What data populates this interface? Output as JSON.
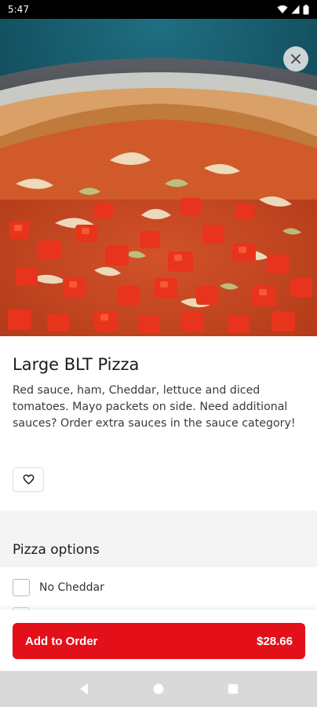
{
  "status_bar": {
    "time": "5:47",
    "icons": [
      "wifi-icon",
      "signal-icon",
      "battery-icon"
    ]
  },
  "hero": {
    "image": "pizza-photo",
    "close_icon": "close-icon"
  },
  "item": {
    "title": "Large BLT Pizza",
    "description": "Red sauce, ham, Cheddar, lettuce and diced tomatoes. Mayo packets on side. Need additional sauces? Order extra sauces in the sauce category!",
    "favorite_icon": "heart-outline-icon"
  },
  "options": {
    "title": "Pizza options",
    "items": [
      {
        "label": "No Cheddar",
        "checked": false
      }
    ]
  },
  "footer": {
    "add_label": "Add to Order",
    "price": "$28.66",
    "accent_color": "#e3101a"
  },
  "nav_bar": {
    "icons": [
      "back-icon",
      "home-icon",
      "recents-icon"
    ]
  }
}
